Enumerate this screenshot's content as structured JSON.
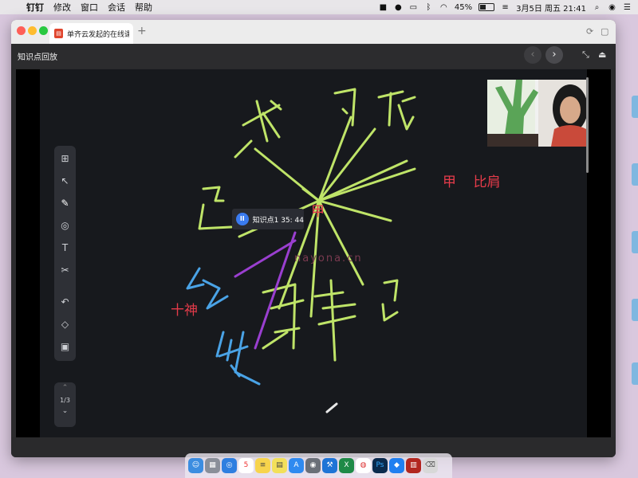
{
  "menubar": {
    "app_name": "钉钉",
    "menus": [
      "修改",
      "窗口",
      "会话",
      "帮助"
    ],
    "battery": "45%",
    "datetime": "3月5日 周五  21:41"
  },
  "window": {
    "tab_title": "单齐云发起的在线课",
    "new_tab": "+",
    "header_title": "知识点回放"
  },
  "board": {
    "playback_label": "知识点1 35: 44",
    "watermark": "nayona.cn",
    "notes": {
      "jia": "甲",
      "jia_bijian": "甲    比肩",
      "shishen": "十神"
    },
    "pager": "1/3"
  },
  "colors": {
    "green_stroke": "#bfe468",
    "blue_stroke": "#4aa3e6",
    "purple_stroke": "#9a3fd0",
    "red_text": "#e53b4a",
    "board_bg": "#17191d",
    "accent_blue": "#3a7bf0"
  },
  "toolbar_icons": [
    "add-page-icon",
    "cursor-icon",
    "pen-icon",
    "shapes-icon",
    "text-icon",
    "scissors-icon",
    "undo-icon",
    "eraser-icon",
    "toolbox-icon"
  ],
  "dock_icons": [
    "finder-icon",
    "launchpad-icon",
    "safari-icon",
    "calendar-icon",
    "notes-icon",
    "stickies-icon",
    "appstore-icon",
    "disk-utility-icon",
    "xcode-icon",
    "excel-icon",
    "chrome-icon",
    "photoshop-icon",
    "dingtalk-icon",
    "dictionary-icon",
    "trash-icon"
  ]
}
